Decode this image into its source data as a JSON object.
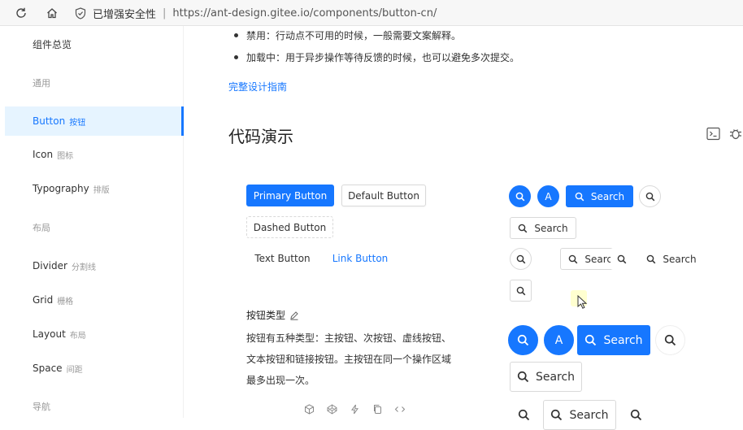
{
  "browser": {
    "security_label": "已增强安全性",
    "url": "https://ant-design.gitee.io/components/button-cn/"
  },
  "sidebar": {
    "items": [
      {
        "label": "组件总览",
        "sub": ""
      },
      {
        "group": "通用"
      },
      {
        "label": "Button",
        "sub": "按钮",
        "active": true
      },
      {
        "label": "Icon",
        "sub": "图标"
      },
      {
        "label": "Typography",
        "sub": "排版"
      },
      {
        "group": "布局"
      },
      {
        "label": "Divider",
        "sub": "分割线"
      },
      {
        "label": "Grid",
        "sub": "栅格"
      },
      {
        "label": "Layout",
        "sub": "布局"
      },
      {
        "label": "Space",
        "sub": "间距"
      },
      {
        "group": "导航"
      }
    ]
  },
  "content": {
    "bullets": [
      "禁用：行动点不可用的时候，一般需要文案解释。",
      "加载中：用于异步操作等待反馈的时候，也可以避免多次提交。"
    ],
    "guide_link": "完整设计指南",
    "section_title": "代码演示"
  },
  "demo_basic": {
    "primary": "Primary Button",
    "default": "Default Button",
    "dashed": "Dashed Button",
    "text": "Text Button",
    "link": "Link Button",
    "desc_title": "按钮类型",
    "desc_lines": [
      "按钮有五种类型：主按钮、次按钮、虚线按钮、",
      "文本按钮和链接按钮。主按钮在同一个操作区域",
      "最多出现一次。"
    ]
  },
  "demo_icon": {
    "letter": "A",
    "search": "Search"
  },
  "colors": {
    "primary": "#1677ff",
    "border": "#d9d9d9",
    "active_bg": "#e6f4ff"
  }
}
